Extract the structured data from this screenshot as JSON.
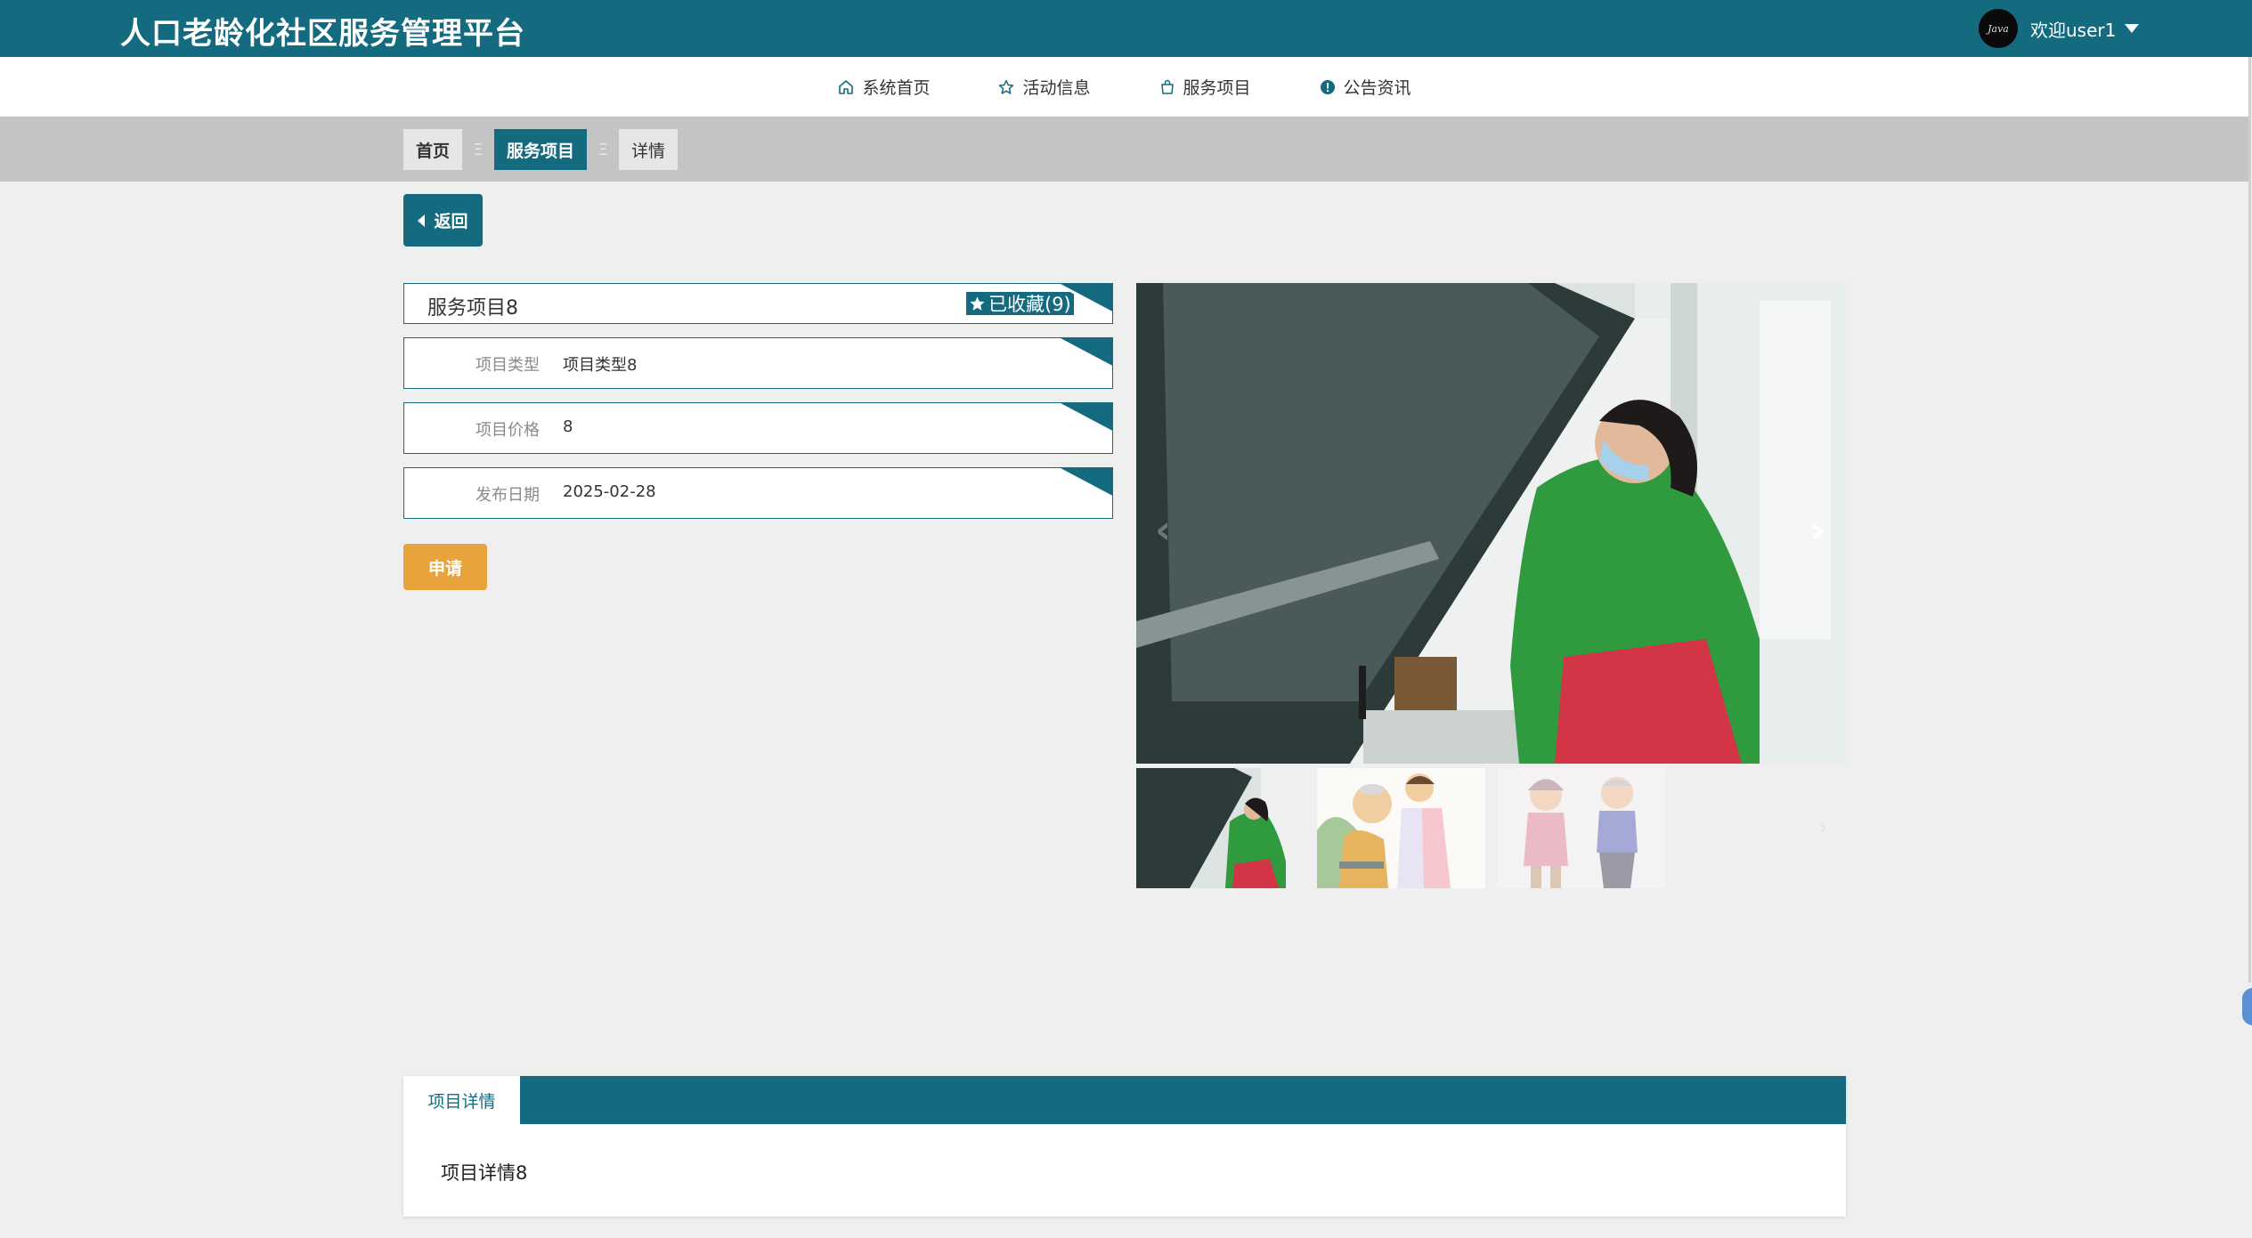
{
  "header": {
    "app_title": "人口老龄化社区服务管理平台",
    "avatar_text": "Java",
    "welcome_text": "欢迎user1"
  },
  "nav": {
    "items": [
      {
        "label": "系统首页",
        "icon": "home-icon"
      },
      {
        "label": "活动信息",
        "icon": "star-outline-icon"
      },
      {
        "label": "服务项目",
        "icon": "bag-icon"
      },
      {
        "label": "公告资讯",
        "icon": "info-circle-icon"
      }
    ]
  },
  "breadcrumb": {
    "items": [
      "首页",
      "服务项目",
      "详情"
    ],
    "separator": "Ξ"
  },
  "back_button": {
    "label": "返回"
  },
  "detail": {
    "title": "服务项目8",
    "favorite_label": "已收藏(9)",
    "fields": [
      {
        "label": "项目类型",
        "value": "项目类型8"
      },
      {
        "label": "项目价格",
        "value": "8"
      },
      {
        "label": "发布日期",
        "value": "2025-02-28"
      }
    ]
  },
  "apply_button": {
    "label": "申请"
  },
  "gallery": {
    "prev_arrow": "‹",
    "next_arrow": "›",
    "thumb_next": "›"
  },
  "tabs": {
    "active_label": "项目详情",
    "content": "项目详情8"
  },
  "colors": {
    "primary": "#146b80",
    "apply": "#e8a33d",
    "background": "#efefef",
    "breadcrumb_band": "#c4c4c4"
  }
}
